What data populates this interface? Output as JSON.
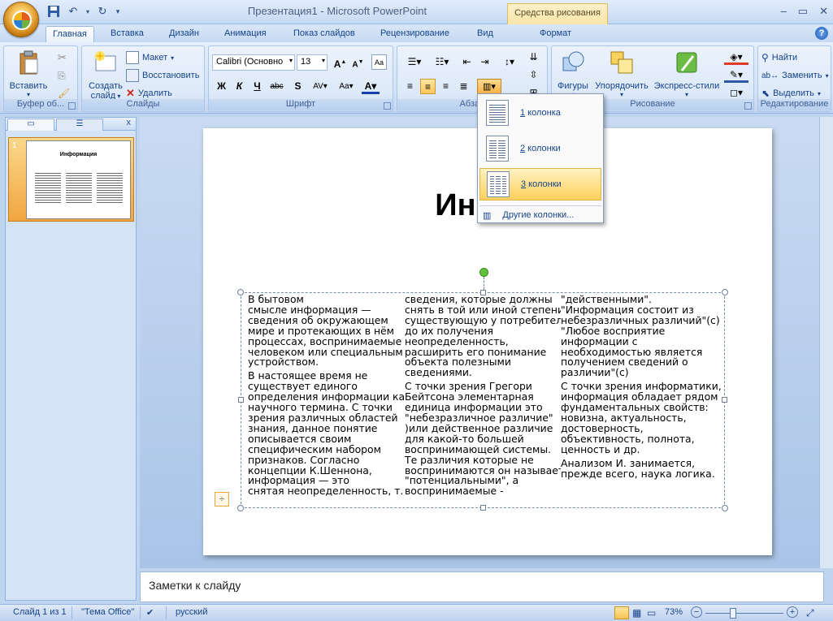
{
  "window": {
    "title": "Презентация1 - Microsoft PowerPoint",
    "contextual_tab_header": "Средства рисования"
  },
  "tabs": [
    "Главная",
    "Вставка",
    "Дизайн",
    "Анимация",
    "Показ слайдов",
    "Рецензирование",
    "Вид",
    "Формат"
  ],
  "ribbon": {
    "clipboard": {
      "paste": "Вставить",
      "group": "Буфер об..."
    },
    "slides": {
      "new_slide_line1": "Создать",
      "new_slide_line2": "слайд",
      "layout": "Макет",
      "reset": "Восстановить",
      "delete": "Удалить",
      "group": "Слайды"
    },
    "font": {
      "font_name": "Calibri (Основно",
      "font_size": "13",
      "group": "Шрифт"
    },
    "paragraph": {
      "group": "Абзац"
    },
    "drawing": {
      "shapes": "Фигуры",
      "arrange": "Упорядочить",
      "quick_styles": "Экспресс-стили",
      "group": "Рисование"
    },
    "editing": {
      "find": "Найти",
      "replace": "Заменить",
      "select": "Выделить",
      "group": "Редактирование"
    }
  },
  "columns_menu": {
    "items": [
      {
        "num": "1",
        "label": " колонка"
      },
      {
        "num": "2",
        "label": " колонки"
      },
      {
        "num": "3",
        "label": " колонки"
      }
    ],
    "more_prefix": "Д",
    "more_rest": "ругие колонки..."
  },
  "slide_pane": {
    "slide_number": "1",
    "thumb_title": "Информация"
  },
  "slide": {
    "title": "Инфор",
    "col1": [
      [
        "В бытовом",
        "смысле информация —",
        "сведения об окружающем",
        "мире и протекающих в нём",
        "процессах, воспринимаемые",
        "человеком или специальным",
        "устройством."
      ],
      [
        "В настоящее время не",
        "существует единого",
        "определения информации как",
        "научного термина. С точки",
        "зрения различных областей",
        "знания, данное понятие",
        "описывается своим",
        "специфическим набором",
        "признаков. Согласно",
        "концепции К.Шеннона,",
        "информация — это",
        "снятая неопределенность, т.е."
      ]
    ],
    "col2": [
      [
        "сведения, которые должны",
        "снять в той или иной степени",
        "существующую у потребителя",
        "до их получения",
        "неопределенность,",
        "расширить его понимание",
        "объекта полезными",
        "сведениями."
      ],
      [
        "С точки зрения Грегори",
        "Бейтсона элементарная",
        "единица информации это",
        "\"небезразличное различие\"",
        ")или действенное различие",
        "для какой-то большей",
        "воспринимающей системы.",
        "Те различия которые не",
        "воспринимаются он называет",
        "\"потенциальными\", а",
        "воспринимаемые -"
      ]
    ],
    "col3": [
      [
        "\"действенными\".",
        "\"Информация состоит из",
        "небезразличных различий\"(с)",
        "\"Любое восприятие",
        "информации с",
        "необходимостью является",
        "получением сведений о",
        "различии\"(с)"
      ],
      [
        "С точки зрения информатики,",
        "информация обладает рядом",
        "фундаментальных свойств:",
        "новизна, актуальность,",
        "достоверность,",
        "объективность, полнота,",
        "ценность и др."
      ],
      [
        "Анализом И. занимается,",
        "прежде всего, наука логика."
      ]
    ]
  },
  "notes_placeholder": "Заметки к слайду",
  "status": {
    "slide_info": "Слайд 1 из 1",
    "theme": "\"Тема Office\"",
    "language": "русский",
    "zoom": "73%"
  }
}
